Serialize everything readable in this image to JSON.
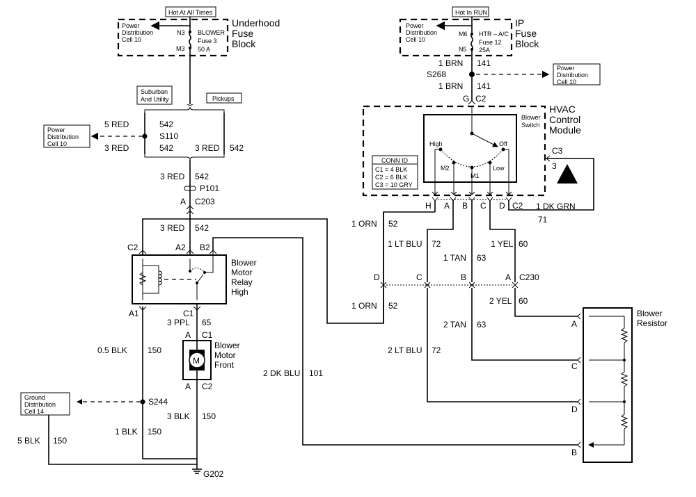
{
  "underhood": {
    "hot_label": "Hot At All Times",
    "title": [
      "Underhood",
      "Fuse",
      "Block"
    ],
    "power_dist": [
      "Power",
      "Distribution",
      "Cell 10"
    ],
    "pin_in": "N3",
    "pin_out": "M3",
    "fuse": [
      "BLOWER",
      "Fuse 3",
      "50 A"
    ]
  },
  "variants": {
    "left": [
      "Suburban",
      "And Utility"
    ],
    "right": "Pickups"
  },
  "s110": {
    "wire_top": [
      "5 RED",
      "542"
    ],
    "splice": "S110",
    "wire_left": [
      "3 RED",
      "542"
    ],
    "wire_right": [
      "3 RED",
      "542"
    ],
    "power_dist": [
      "Power",
      "Distribution",
      "Cell 10"
    ]
  },
  "feed": {
    "wire": [
      "3 RED",
      "542"
    ],
    "p101": "P101",
    "c203": [
      "A",
      "C203"
    ],
    "wire2": [
      "3 RED",
      "542"
    ]
  },
  "relay": {
    "title": [
      "Blower",
      "Motor",
      "Relay",
      "High"
    ],
    "pins": {
      "c2": "C2",
      "a2": "A2",
      "b2": "B2",
      "a1": "A1",
      "c1": "C1"
    }
  },
  "motor": {
    "title": [
      "Blower",
      "Motor",
      "Front"
    ],
    "symbol": "M",
    "wire_in": [
      "3 PPL",
      "65"
    ],
    "conn_top": [
      "A",
      "C1"
    ],
    "conn_bottom": [
      "A",
      "C2"
    ],
    "wire_out": [
      "3 BLK",
      "150"
    ]
  },
  "ground": {
    "wire_a1": [
      "0.5 BLK",
      "150"
    ],
    "splice": "S244",
    "dist": [
      "Ground",
      "Distribution",
      "Cell 14"
    ],
    "wire_1blk": [
      "1 BLK",
      "150"
    ],
    "wire_5blk": [
      "5 BLK",
      "150"
    ],
    "ground_id": "G202"
  },
  "dk_blu": [
    "2 DK BLU",
    "101"
  ],
  "ip_fuse": {
    "hot_label": "Hot In RUN",
    "title": [
      "IP",
      "Fuse",
      "Block"
    ],
    "power_dist": [
      "Power",
      "Distribution",
      "Cell 10"
    ],
    "pin_in": "M6",
    "pin_out": "N5",
    "fuse": [
      "HTR – A/C",
      "Fuse 12",
      "25A"
    ]
  },
  "s268": {
    "wire_top": [
      "1 BRN",
      "141"
    ],
    "splice": "S268",
    "wire_bottom": [
      "1 BRN",
      "141"
    ],
    "conn": [
      "G",
      "C2"
    ],
    "power_dist": [
      "Power",
      "Distribution",
      "Cell 10"
    ]
  },
  "hvac": {
    "title": [
      "HVAC",
      "Control",
      "Module"
    ],
    "switch_label": [
      "Blower",
      "Switch"
    ],
    "positions": {
      "high": "High",
      "m2": "M2",
      "m1": "M1",
      "low": "Low",
      "off": "Off"
    },
    "conn_id": {
      "title": "CONN ID",
      "rows": [
        "C1 = 4 BLK",
        "C2 = 6 BLK",
        "C3 = 10 GRY"
      ]
    },
    "pins": [
      "H",
      "A",
      "B",
      "C",
      "D",
      "C2"
    ],
    "c3": {
      "conn": "C3",
      "pin": "3",
      "icon": "esd-warning-icon"
    },
    "dk_grn": [
      "1 DK GRN",
      "71"
    ]
  },
  "harness": {
    "orn_top": [
      "1 ORN",
      "52"
    ],
    "lt_blu_top": [
      "1 LT BLU",
      "72"
    ],
    "tan_top": [
      "1 TAN",
      "63"
    ],
    "yel_top": [
      "1 YEL",
      "60"
    ],
    "c230_pins": [
      "D",
      "C",
      "B",
      "A"
    ],
    "c230": "C230",
    "orn_bottom": [
      "1 ORN",
      "52"
    ],
    "yel_bottom": [
      "2 YEL",
      "60"
    ],
    "tan_bottom": [
      "2 TAN",
      "63"
    ],
    "lt_blu_bottom": [
      "2 LT BLU",
      "72"
    ]
  },
  "resistor": {
    "title": [
      "Blower",
      "Resistor"
    ],
    "pins": [
      "A",
      "C",
      "D",
      "B"
    ]
  }
}
